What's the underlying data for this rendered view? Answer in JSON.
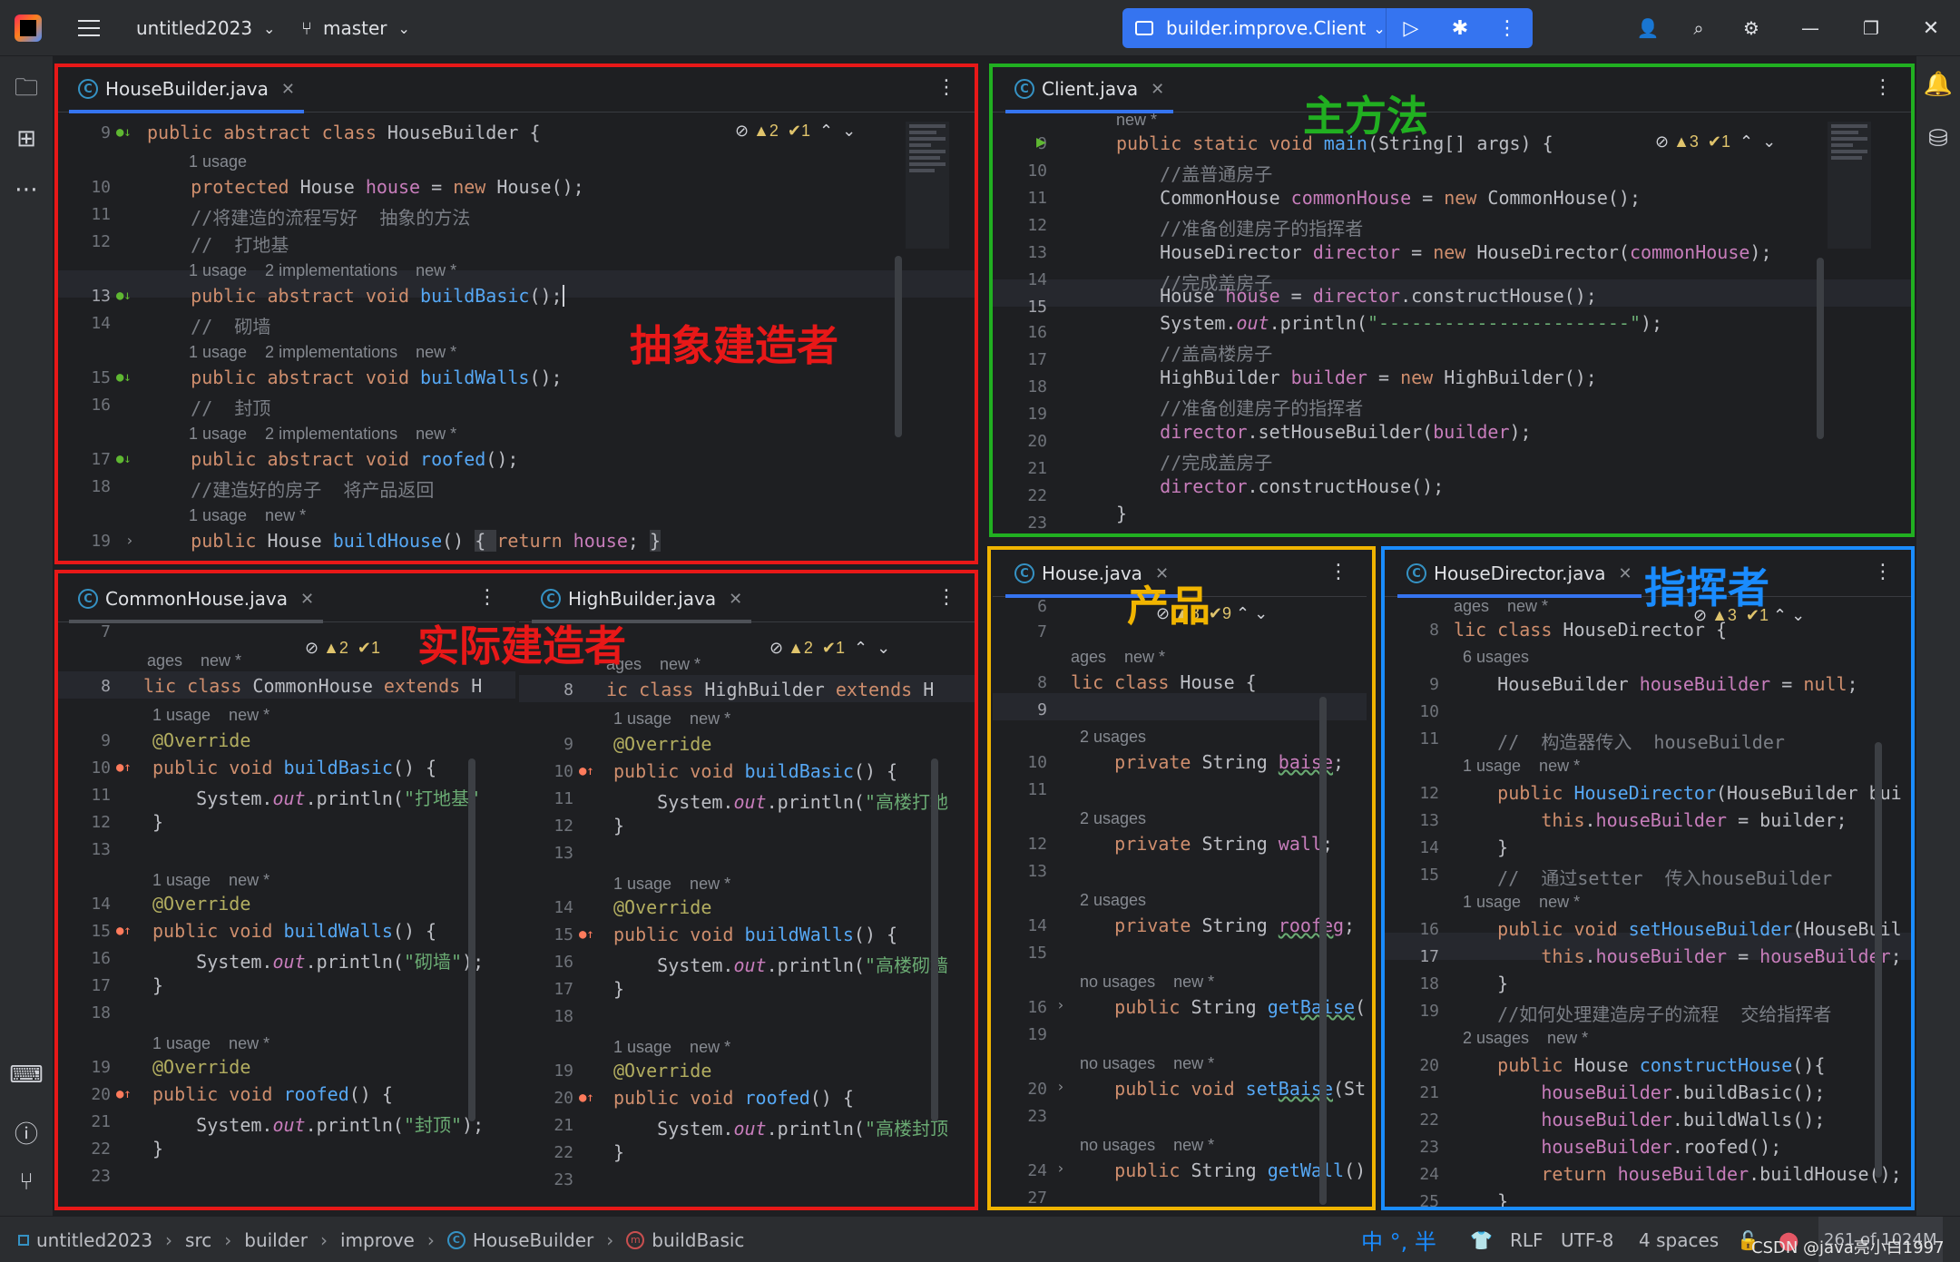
{
  "titlebar": {
    "project": "untitled2023",
    "branch": "master",
    "run_config": "builder.improve.Client"
  },
  "labels": {
    "abstract_builder": "抽象建造者",
    "concrete_builder": "实际建造者",
    "main_method": "主方法",
    "product": "产品",
    "director": "指挥者"
  },
  "pane1": {
    "tab": "HouseBuilder.java",
    "inspections": "▲2  ✔1",
    "lines": [
      {
        "n": "9",
        "t": "public abstract class HouseBuilder {"
      },
      {
        "hint": "1 usage"
      },
      {
        "n": "10",
        "t": "    protected House house = new House();"
      },
      {
        "n": "11",
        "t": "    //将建造的流程写好  抽象的方法"
      },
      {
        "n": "12",
        "t": "    //  打地基"
      },
      {
        "hint": "1 usage    2 implementations    new *"
      },
      {
        "n": "13",
        "t": "    public abstract void buildBasic();"
      },
      {
        "n": "14",
        "t": "    //  砌墙"
      },
      {
        "hint": "1 usage    2 implementations    new *"
      },
      {
        "n": "15",
        "t": "    public abstract void buildWalls();"
      },
      {
        "n": "16",
        "t": "    //  封顶"
      },
      {
        "hint": "1 usage    2 implementations    new *"
      },
      {
        "n": "17",
        "t": "    public abstract void roofed();"
      },
      {
        "n": "18",
        "t": "    //建造好的房子  将产品返回"
      },
      {
        "hint": "1 usage    new *"
      },
      {
        "n": "19",
        "t": "    public House buildHouse() { return house; }"
      }
    ]
  },
  "pane2": {
    "tab": "Client.java",
    "inspections": "▲3  ✔1",
    "lines": [
      {
        "hint": "new *"
      },
      {
        "n": "9",
        "t": "public static void main(String[] args) {"
      },
      {
        "n": "10",
        "t": "    //盖普通房子"
      },
      {
        "n": "11",
        "t": "    CommonHouse commonHouse = new CommonHouse();"
      },
      {
        "n": "12",
        "t": "    //准备创建房子的指挥者"
      },
      {
        "n": "13",
        "t": "    HouseDirector director = new HouseDirector(commonHouse);"
      },
      {
        "n": "14",
        "t": "    //完成盖房子"
      },
      {
        "n": "15",
        "t": "    House house = director.constructHouse();"
      },
      {
        "n": "16",
        "t": "    System.out.println(\"-----------------------\");"
      },
      {
        "n": "17",
        "t": "    //盖高楼房子"
      },
      {
        "n": "18",
        "t": "    HighBuilder builder = new HighBuilder();"
      },
      {
        "n": "19",
        "t": "    //准备创建房子的指挥者"
      },
      {
        "n": "20",
        "t": "    director.setHouseBuilder(builder);"
      },
      {
        "n": "21",
        "t": "    //完成盖房子"
      },
      {
        "n": "22",
        "t": "    director.constructHouse();"
      },
      {
        "n": "23",
        "t": "}"
      }
    ]
  },
  "pane3": {
    "tab": "CommonHouse.java",
    "inspections": "▲2  ✔1",
    "lines": [
      {
        "n": "7",
        "t": ""
      },
      {
        "hint": "ages    new *"
      },
      {
        "n": "8",
        "t": "lic class CommonHouse extends H"
      },
      {
        "hint": "1 usage    new *"
      },
      {
        "n": "9",
        "t": "@Override"
      },
      {
        "n": "10",
        "t": "public void buildBasic() {"
      },
      {
        "n": "11",
        "t": "    System.out.println(\"打地基\""
      },
      {
        "n": "12",
        "t": "}"
      },
      {
        "n": "13",
        "t": ""
      },
      {
        "hint": "1 usage    new *"
      },
      {
        "n": "14",
        "t": "@Override"
      },
      {
        "n": "15",
        "t": "public void buildWalls() {"
      },
      {
        "n": "16",
        "t": "    System.out.println(\"砌墙\");"
      },
      {
        "n": "17",
        "t": "}"
      },
      {
        "n": "18",
        "t": ""
      },
      {
        "hint": "1 usage    new *"
      },
      {
        "n": "19",
        "t": "@Override"
      },
      {
        "n": "20",
        "t": "public void roofed() {"
      },
      {
        "n": "21",
        "t": "    System.out.println(\"封顶\");"
      },
      {
        "n": "22",
        "t": "}"
      },
      {
        "n": "23",
        "t": ""
      }
    ]
  },
  "pane4": {
    "tab": "HighBuilder.java",
    "inspections": "▲2  ✔1",
    "lines": [
      {
        "hint": "ages    new *"
      },
      {
        "n": "8",
        "t": "ic class HighBuilder extends H"
      },
      {
        "hint": "1 usage    new *"
      },
      {
        "n": "9",
        "t": "@Override"
      },
      {
        "n": "10",
        "t": "public void buildBasic() {"
      },
      {
        "n": "11",
        "t": "    System.out.println(\"高楼打地"
      },
      {
        "n": "12",
        "t": "}"
      },
      {
        "n": "13",
        "t": ""
      },
      {
        "hint": "1 usage    new *"
      },
      {
        "n": "14",
        "t": "@Override"
      },
      {
        "n": "15",
        "t": "public void buildWalls() {"
      },
      {
        "n": "16",
        "t": "    System.out.println(\"高楼砌墙"
      },
      {
        "n": "17",
        "t": "}"
      },
      {
        "n": "18",
        "t": ""
      },
      {
        "hint": "1 usage    new *"
      },
      {
        "n": "19",
        "t": "@Override"
      },
      {
        "n": "20",
        "t": "public void roofed() {"
      },
      {
        "n": "21",
        "t": "    System.out.println(\"高楼封顶"
      },
      {
        "n": "22",
        "t": "}"
      },
      {
        "n": "23",
        "t": ""
      }
    ]
  },
  "pane5": {
    "tab": "House.java",
    "inspections": "▲8  ✔9",
    "lines": [
      {
        "n": "6",
        "t": ""
      },
      {
        "n": "7",
        "t": ""
      },
      {
        "hint": "ages    new *"
      },
      {
        "n": "8",
        "t": "lic class House {"
      },
      {
        "n": "9",
        "t": ""
      },
      {
        "hint": "2 usages"
      },
      {
        "n": "10",
        "t": "    private String baise;"
      },
      {
        "n": "11",
        "t": ""
      },
      {
        "hint": "2 usages"
      },
      {
        "n": "12",
        "t": "    private String wall;"
      },
      {
        "n": "13",
        "t": ""
      },
      {
        "hint": "2 usages"
      },
      {
        "n": "14",
        "t": "    private String roofeg;"
      },
      {
        "n": "15",
        "t": ""
      },
      {
        "hint": "no usages    new *"
      },
      {
        "n": "16",
        "t": "    public String getBaise("
      },
      {
        "n": "19",
        "t": ""
      },
      {
        "hint": "no usages    new *"
      },
      {
        "n": "20",
        "t": "    public void setBaise(St"
      },
      {
        "n": "23",
        "t": ""
      },
      {
        "hint": "no usages    new *"
      },
      {
        "n": "24",
        "t": "    public String getWall()"
      },
      {
        "n": "27",
        "t": ""
      }
    ]
  },
  "pane6": {
    "tab": "HouseDirector.java",
    "inspections": "▲3  ✔1",
    "lines": [
      {
        "hint": "ages    new *"
      },
      {
        "n": "8",
        "t": "lic class HouseDirector {"
      },
      {
        "hint": "6 usages"
      },
      {
        "n": "9",
        "t": "    HouseBuilder houseBuilder = null;"
      },
      {
        "n": "10",
        "t": ""
      },
      {
        "n": "11",
        "t": "    //  构造器传入  houseBuilder"
      },
      {
        "hint": "1 usage    new *"
      },
      {
        "n": "12",
        "t": "    public HouseDirector(HouseBuilder bui"
      },
      {
        "n": "13",
        "t": "        this.houseBuilder = builder;"
      },
      {
        "n": "14",
        "t": "    }"
      },
      {
        "n": "15",
        "t": "    //  通过setter  传入houseBuilder"
      },
      {
        "hint": "1 usage    new *"
      },
      {
        "n": "16",
        "t": "    public void setHouseBuilder(HouseBuil"
      },
      {
        "n": "17",
        "t": "        this.houseBuilder = houseBuilder;"
      },
      {
        "n": "18",
        "t": "    }"
      },
      {
        "n": "19",
        "t": "    //如何处理建造房子的流程  交给指挥者"
      },
      {
        "hint": "2 usages    new *"
      },
      {
        "n": "20",
        "t": "    public House constructHouse(){"
      },
      {
        "n": "21",
        "t": "        houseBuilder.buildBasic();"
      },
      {
        "n": "22",
        "t": "        houseBuilder.buildWalls();"
      },
      {
        "n": "23",
        "t": "        houseBuilder.roofed();"
      },
      {
        "n": "24",
        "t": "        return houseBuilder.buildHouse();"
      },
      {
        "n": "25",
        "t": "    }"
      }
    ]
  },
  "statusbar": {
    "crumbs": [
      "untitled2023",
      "src",
      "builder",
      "improve",
      "HouseBuilder",
      "buildBasic"
    ],
    "ime": "中  °,  半",
    "line_sep": "RLF",
    "encoding": "UTF-8",
    "indent": "4 spaces",
    "memory": "261 of 1024M",
    "watermark": "CSDN @java亮小白1997"
  },
  "colors": {
    "red": "#e81818",
    "green": "#21b021",
    "yellow": "#f0b400",
    "blue": "#1a8cff",
    "accent": "#3574f0"
  }
}
